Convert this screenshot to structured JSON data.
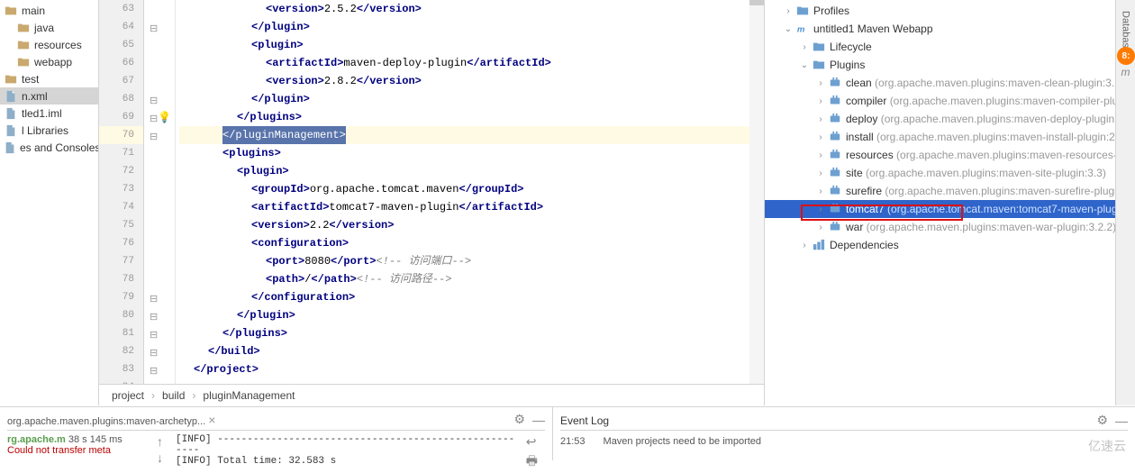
{
  "project_tree": [
    {
      "label": "main",
      "icon": "folder",
      "indent": 0
    },
    {
      "label": "java",
      "icon": "folder-src",
      "indent": 1
    },
    {
      "label": "resources",
      "icon": "folder-res",
      "indent": 1
    },
    {
      "label": "webapp",
      "icon": "folder-web",
      "indent": 1
    },
    {
      "label": "test",
      "icon": "folder",
      "indent": 0
    },
    {
      "label": "n.xml",
      "icon": "file-xml",
      "indent": 0,
      "selected": true
    },
    {
      "label": "tled1.iml",
      "icon": "file",
      "indent": 0
    },
    {
      "label": "l Libraries",
      "icon": "lib",
      "indent": 0
    },
    {
      "label": "es and Consoles",
      "icon": "console",
      "indent": 0
    }
  ],
  "code": {
    "lines": [
      {
        "n": 63,
        "indent": 6,
        "tokens": [
          {
            "t": "tag",
            "v": "<version>"
          },
          {
            "t": "text",
            "v": "2.5.2"
          },
          {
            "t": "tag",
            "v": "</version>"
          }
        ]
      },
      {
        "n": 64,
        "indent": 5,
        "tokens": [
          {
            "t": "tag",
            "v": "</plugin>"
          }
        ]
      },
      {
        "n": 65,
        "indent": 5,
        "tokens": [
          {
            "t": "tag",
            "v": "<plugin>"
          }
        ]
      },
      {
        "n": 66,
        "indent": 6,
        "tokens": [
          {
            "t": "tag",
            "v": "<artifactId>"
          },
          {
            "t": "text",
            "v": "maven-deploy-plugin"
          },
          {
            "t": "tag",
            "v": "</artifactId>"
          }
        ]
      },
      {
        "n": 67,
        "indent": 6,
        "tokens": [
          {
            "t": "tag",
            "v": "<version>"
          },
          {
            "t": "text",
            "v": "2.8.2"
          },
          {
            "t": "tag",
            "v": "</version>"
          }
        ]
      },
      {
        "n": 68,
        "indent": 5,
        "tokens": [
          {
            "t": "tag",
            "v": "</plugin>"
          }
        ]
      },
      {
        "n": 69,
        "indent": 4,
        "tokens": [
          {
            "t": "tag",
            "v": "</plugins>"
          }
        ],
        "bulb": true
      },
      {
        "n": 70,
        "indent": 3,
        "tokens": [
          {
            "t": "sel",
            "v": "</pluginManagement>"
          }
        ],
        "highlighted": true
      },
      {
        "n": 71,
        "indent": 3,
        "tokens": [
          {
            "t": "tag",
            "v": "<plugins>"
          }
        ]
      },
      {
        "n": 72,
        "indent": 4,
        "tokens": [
          {
            "t": "tag",
            "v": "<plugin>"
          }
        ]
      },
      {
        "n": 73,
        "indent": 5,
        "tokens": [
          {
            "t": "tag",
            "v": "<groupId>"
          },
          {
            "t": "text",
            "v": "org.apache.tomcat.maven"
          },
          {
            "t": "tag",
            "v": "</groupId>"
          }
        ]
      },
      {
        "n": 74,
        "indent": 5,
        "tokens": [
          {
            "t": "tag",
            "v": "<artifactId>"
          },
          {
            "t": "text",
            "v": "tomcat7-maven-plugin"
          },
          {
            "t": "tag",
            "v": "</artifactId>"
          }
        ]
      },
      {
        "n": 75,
        "indent": 5,
        "tokens": [
          {
            "t": "tag",
            "v": "<version>"
          },
          {
            "t": "text",
            "v": "2.2"
          },
          {
            "t": "tag",
            "v": "</version>"
          }
        ]
      },
      {
        "n": 76,
        "indent": 5,
        "tokens": [
          {
            "t": "tag",
            "v": "<configuration>"
          }
        ]
      },
      {
        "n": 77,
        "indent": 6,
        "tokens": [
          {
            "t": "tag",
            "v": "<port>"
          },
          {
            "t": "text",
            "v": "8080"
          },
          {
            "t": "tag",
            "v": "</port>"
          },
          {
            "t": "pad",
            "v": " "
          },
          {
            "t": "comment",
            "v": "<!-- 访问端口-->"
          }
        ]
      },
      {
        "n": 78,
        "indent": 6,
        "tokens": [
          {
            "t": "tag",
            "v": "<path>"
          },
          {
            "t": "text",
            "v": "/"
          },
          {
            "t": "tag",
            "v": "</path>"
          },
          {
            "t": "pad",
            "v": "    "
          },
          {
            "t": "comment",
            "v": "<!-- 访问路径-->"
          }
        ]
      },
      {
        "n": 79,
        "indent": 5,
        "tokens": [
          {
            "t": "tag",
            "v": "</configuration>"
          }
        ]
      },
      {
        "n": 80,
        "indent": 4,
        "tokens": [
          {
            "t": "tag",
            "v": "</plugin>"
          }
        ]
      },
      {
        "n": 81,
        "indent": 3,
        "tokens": [
          {
            "t": "tag",
            "v": "</plugins>"
          }
        ]
      },
      {
        "n": 82,
        "indent": 2,
        "tokens": [
          {
            "t": "tag",
            "v": "</build>"
          }
        ]
      },
      {
        "n": 83,
        "indent": 1,
        "tokens": [
          {
            "t": "tag",
            "v": "</project>"
          }
        ]
      },
      {
        "n": 84,
        "indent": 0,
        "tokens": []
      }
    ]
  },
  "breadcrumb": {
    "items": [
      "project",
      "build",
      "pluginManagement"
    ]
  },
  "maven": {
    "root": [
      {
        "label": "Profiles",
        "icon": "profiles",
        "indent": 1,
        "arrow": "›"
      },
      {
        "label": "untitled1 Maven Webapp",
        "icon": "maven",
        "indent": 1,
        "arrow": "⌄"
      },
      {
        "label": "Lifecycle",
        "icon": "lifecycle",
        "indent": 2,
        "arrow": "›"
      },
      {
        "label": "Plugins",
        "icon": "plugins",
        "indent": 2,
        "arrow": "⌄"
      },
      {
        "label": "clean",
        "suffix": "(org.apache.maven.plugins:maven-clean-plugin:3.1.",
        "icon": "plugin",
        "indent": 3,
        "arrow": "›"
      },
      {
        "label": "compiler",
        "suffix": "(org.apache.maven.plugins:maven-compiler-plu",
        "icon": "plugin",
        "indent": 3,
        "arrow": "›"
      },
      {
        "label": "deploy",
        "suffix": "(org.apache.maven.plugins:maven-deploy-plugin",
        "icon": "plugin",
        "indent": 3,
        "arrow": "›"
      },
      {
        "label": "install",
        "suffix": "(org.apache.maven.plugins:maven-install-plugin:2.",
        "icon": "plugin",
        "indent": 3,
        "arrow": "›"
      },
      {
        "label": "resources",
        "suffix": "(org.apache.maven.plugins:maven-resources-p",
        "icon": "plugin",
        "indent": 3,
        "arrow": "›"
      },
      {
        "label": "site",
        "suffix": "(org.apache.maven.plugins:maven-site-plugin:3.3)",
        "icon": "plugin",
        "indent": 3,
        "arrow": "›"
      },
      {
        "label": "surefire",
        "suffix": "(org.apache.maven.plugins:maven-surefire-plugi",
        "icon": "plugin",
        "indent": 3,
        "arrow": "›"
      },
      {
        "label": "tomcat7",
        "suffix": "(org.apache.tomcat.maven:tomcat7-maven-plug",
        "icon": "plugin",
        "indent": 3,
        "arrow": "›",
        "selected": true
      },
      {
        "label": "war",
        "suffix": "(org.apache.maven.plugins:maven-war-plugin:3.2.2)",
        "icon": "plugin",
        "indent": 3,
        "arrow": "›"
      },
      {
        "label": "Dependencies",
        "icon": "deps",
        "indent": 2,
        "arrow": "›"
      }
    ]
  },
  "side_tabs": {
    "database": "Database",
    "m": "m",
    "badge": "8:"
  },
  "bottom": {
    "left_tab": "org.apache.maven.plugins:maven-archetyp...",
    "console_title": "rg.apache.m",
    "console_time": "38 s 145 ms",
    "console_error": "Could not transfer meta",
    "info1": "[INFO] ------------------------------------------------------",
    "info2": "[INFO] Total time:  32.583 s",
    "event_title": "Event Log",
    "event_time": "21:53",
    "event_msg": "Maven projects need to be imported"
  },
  "watermark": "亿速云"
}
